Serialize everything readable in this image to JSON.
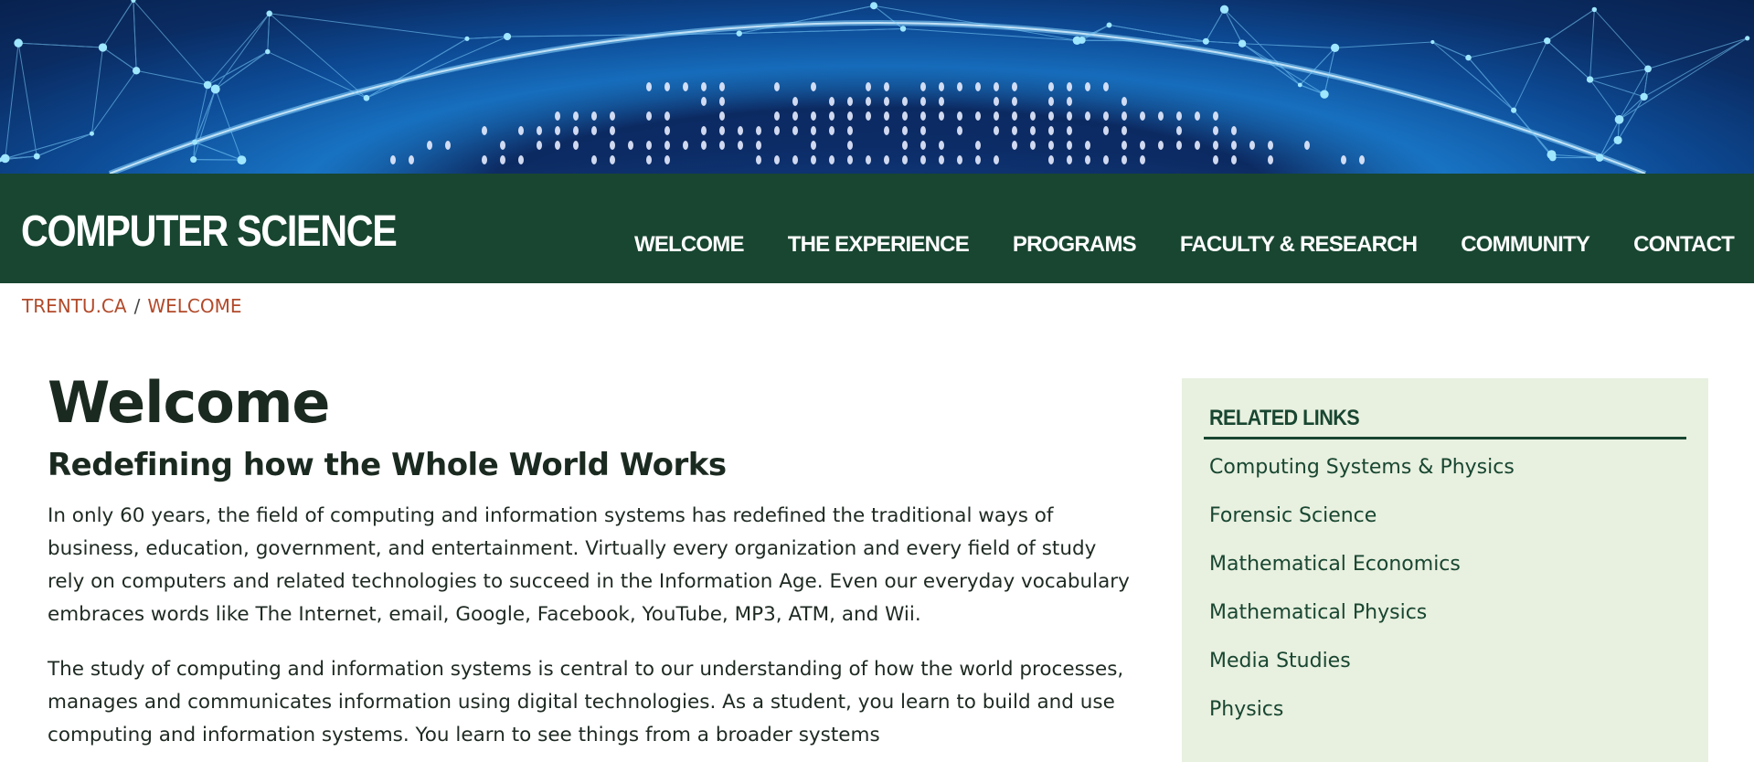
{
  "header": {
    "site_title": "COMPUTER SCIENCE",
    "nav": [
      "WELCOME",
      "THE EXPERIENCE",
      "PROGRAMS",
      "FACULTY & RESEARCH",
      "COMMUNITY",
      "CONTACT"
    ]
  },
  "breadcrumb": {
    "items": [
      "TRENTU.CA",
      "WELCOME"
    ],
    "separator": "/"
  },
  "main": {
    "title": "Welcome",
    "subtitle": "Redefining how the Whole World Works",
    "paragraphs": [
      "In only 60 years, the field of computing and information systems has redefined the traditional ways of business, education, government, and entertainment.  Virtually every organization and every field of study rely on computers and related technologies to succeed in the Information Age.  Even our everyday vocabulary embraces words like The Internet, email, Google, Facebook, YouTube, MP3, ATM, and Wii.",
      "The study of computing and information systems is central to our understanding of how the world processes, manages and communicates information using digital technologies.  As a student, you learn to build and use computing and information systems.  You learn to see things from a broader systems"
    ]
  },
  "sidebar": {
    "heading": "RELATED LINKS",
    "links": [
      "Computing Systems & Physics",
      "Forensic Science",
      "Mathematical Economics",
      "Mathematical Physics",
      "Media Studies",
      "Physics"
    ]
  },
  "colors": {
    "header_green": "#184631",
    "breadcrumb_link": "#b24a2a",
    "sidebar_bg": "#e8f0df",
    "hero_blue": "#1b7fd0"
  }
}
